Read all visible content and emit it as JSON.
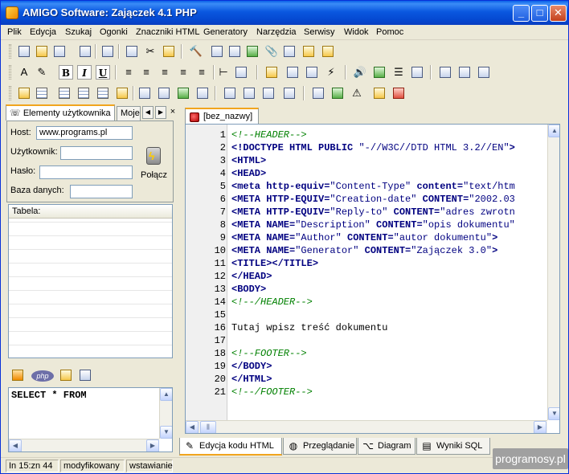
{
  "window": {
    "title": "AMIGO Software: Zajączek 4.1 PHP"
  },
  "menu": [
    "Plik",
    "Edycja",
    "Szukaj",
    "Ogonki",
    "Znaczniki HTML",
    "Generatory",
    "Narzędzia",
    "Serwisy",
    "Widok",
    "Pomoc"
  ],
  "format_buttons": {
    "bold": "B",
    "italic": "I",
    "underline": "U"
  },
  "left_panel": {
    "tab_users": "Elementy użytkownika",
    "tab_other": "Moje",
    "host_label": "Host:",
    "host_value": "www.programs.pl",
    "user_label": "Użytkownik:",
    "user_value": "",
    "password_label": "Hasło:",
    "password_value": "",
    "database_label": "Baza danych:",
    "database_value": "",
    "connect_label": "Połącz",
    "table_header": "Tabela:",
    "sql_query": "SELECT * FROM"
  },
  "editor": {
    "doc_tab": "[bez_nazwy]",
    "lines": [
      {
        "n": "1"
      },
      {
        "n": "2"
      },
      {
        "n": "3"
      },
      {
        "n": "4"
      },
      {
        "n": "5"
      },
      {
        "n": "6"
      },
      {
        "n": "7"
      },
      {
        "n": "8"
      },
      {
        "n": "9"
      },
      {
        "n": "10"
      },
      {
        "n": "11"
      },
      {
        "n": "12"
      },
      {
        "n": "13"
      },
      {
        "n": "14"
      },
      {
        "n": "15"
      },
      {
        "n": "16"
      },
      {
        "n": "17"
      },
      {
        "n": "18"
      },
      {
        "n": "19"
      },
      {
        "n": "20"
      },
      {
        "n": "21"
      }
    ],
    "code": {
      "l1": "<!--HEADER-->",
      "l2a": "<!DOCTYPE HTML PUBLIC ",
      "l2b": "\"-//W3C//DTD HTML 3.2//EN\"",
      "l2c": ">",
      "l3": "<HTML>",
      "l4": "<HEAD>",
      "l5a": "<meta http-equiv=",
      "l5b": "\"Content-Type\"",
      "l5c": " content=",
      "l5d": "\"text/htm",
      "l6a": "<META HTTP-EQUIV=",
      "l6b": "\"Creation-date\"",
      "l6c": " CONTENT=",
      "l6d": "\"2002.03",
      "l7a": "<META HTTP-EQUIV=",
      "l7b": "\"Reply-to\"",
      "l7c": " CONTENT=",
      "l7d": "\"adres zwrotn",
      "l8a": "<META NAME=",
      "l8b": "\"Description\"",
      "l8c": " CONTENT=",
      "l8d": "\"opis dokumentu\"",
      "l9a": "<META NAME=",
      "l9b": "\"Author\"",
      "l9c": " CONTENT=",
      "l9d": "\"autor dokumentu\"",
      "l9e": ">",
      "l10a": "<META NAME=",
      "l10b": "\"Generator\"",
      "l10c": " CONTENT=",
      "l10d": "\"Zajączek 3.0\"",
      "l10e": ">",
      "l11a": "<TITLE>",
      "l11b": "</TITLE>",
      "l12": "</HEAD>",
      "l13": "<BODY>",
      "l14": "<!--/HEADER-->",
      "l15": "",
      "l16": "Tutaj wpisz treść dokumentu",
      "l17": "",
      "l18": "<!--FOOTER-->",
      "l19": "</BODY>",
      "l20": "</HTML>",
      "l21": "<!--/FOOTER-->"
    }
  },
  "bottom_tabs": [
    "Edycja kodu HTML",
    "Przeglądanie",
    "Diagram",
    "Wyniki SQL"
  ],
  "status": {
    "position": "In 15:zn 44",
    "modified": "modyfikowany",
    "mode": "wstawianie"
  },
  "watermark": "programosy.pl"
}
